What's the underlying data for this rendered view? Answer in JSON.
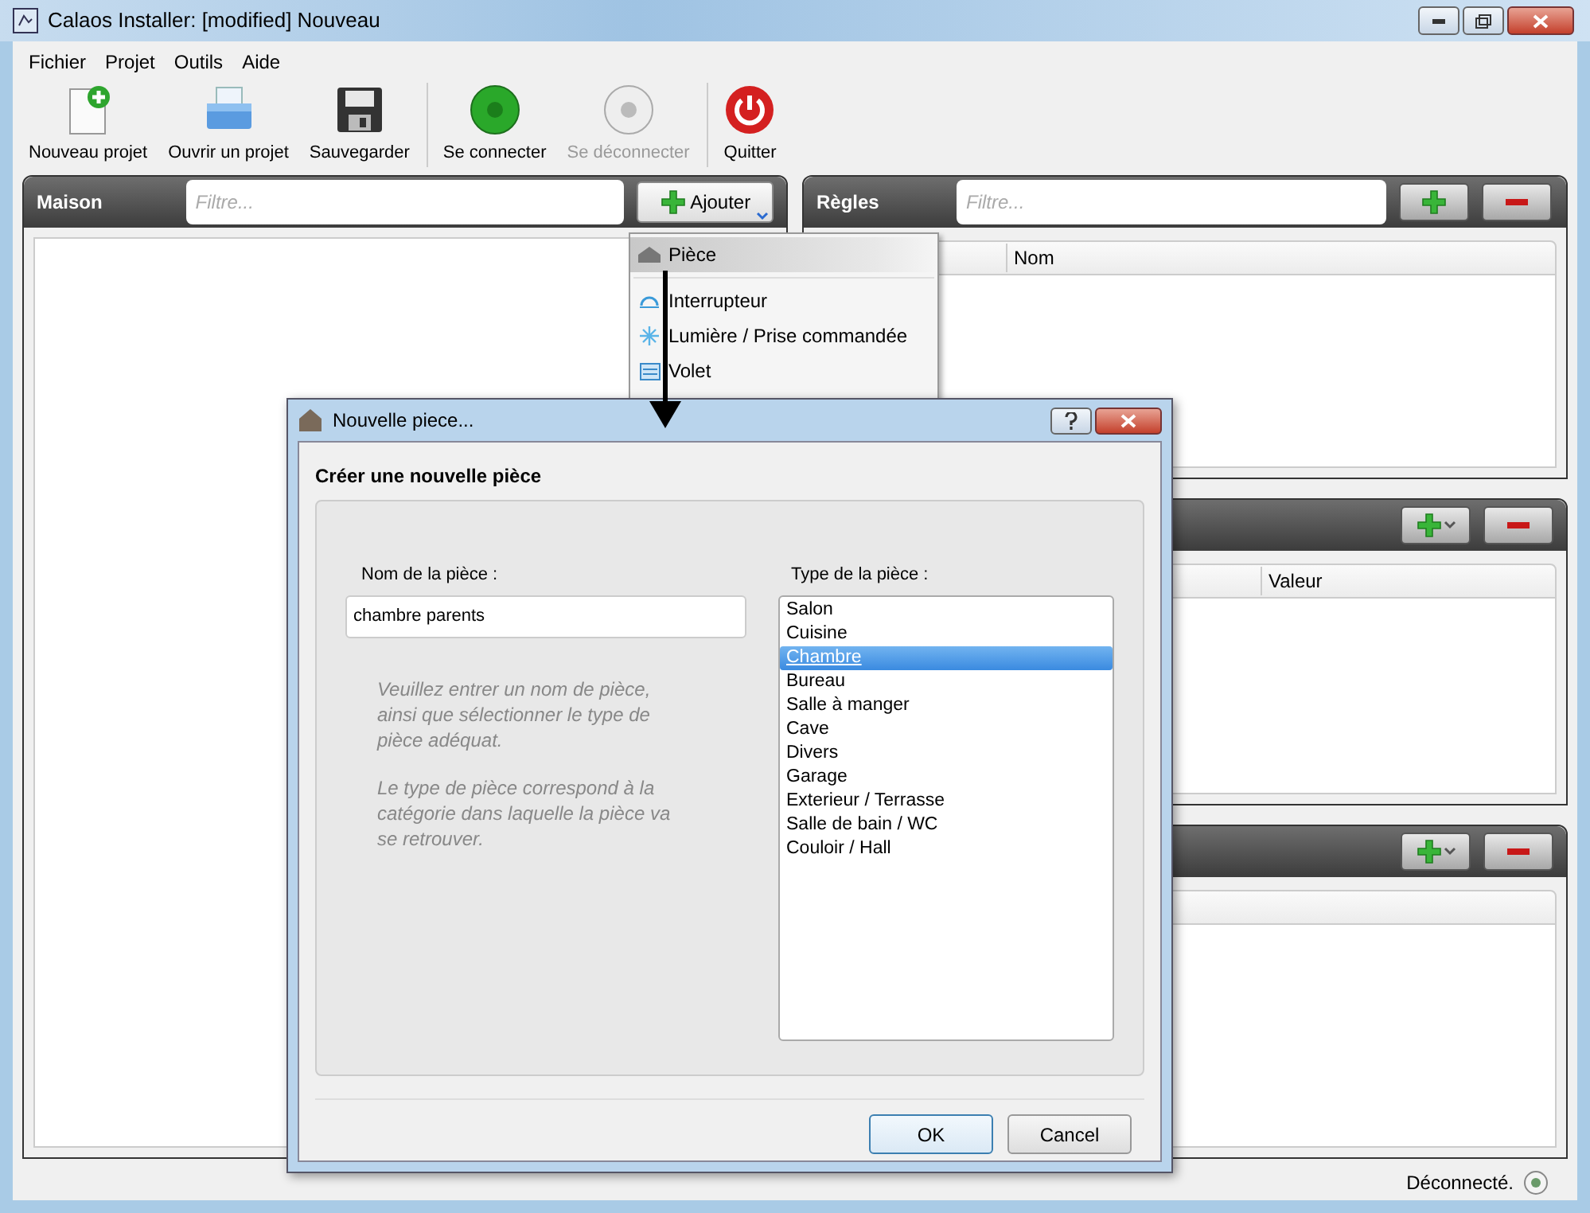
{
  "window": {
    "title": "Calaos Installer: [modified] Nouveau"
  },
  "menu": [
    "Fichier",
    "Projet",
    "Outils",
    "Aide"
  ],
  "toolbar": [
    {
      "kind": "new",
      "label": "Nouveau projet",
      "disabled": false,
      "separator_before": false
    },
    {
      "kind": "open",
      "label": "Ouvrir un projet",
      "disabled": false,
      "separator_before": false
    },
    {
      "kind": "save",
      "label": "Sauvegarder",
      "disabled": false,
      "separator_before": false
    },
    {
      "kind": "connect",
      "label": "Se connecter",
      "disabled": false,
      "separator_before": true
    },
    {
      "kind": "disconnect",
      "label": "Se déconnecter",
      "disabled": true,
      "separator_before": false
    },
    {
      "kind": "quit",
      "label": "Quitter",
      "disabled": false,
      "separator_before": true
    }
  ],
  "house_panel": {
    "title": "Maison",
    "filter": {
      "placeholder": "Filtre..."
    },
    "add_button": "Ajouter"
  },
  "rules_panel": {
    "title": "Règles",
    "filter": {
      "placeholder": "Filtre..."
    },
    "columns": [
      "Nom"
    ]
  },
  "panel_2": {
    "columns": [
      "Valeur"
    ]
  },
  "add_menu": [
    {
      "kind": "room",
      "label": "Pièce",
      "selected": true
    },
    {
      "kind": "switch",
      "label": "Interrupteur",
      "selected": false
    },
    {
      "kind": "light",
      "label": "Lumière / Prise commandée",
      "selected": false
    },
    {
      "kind": "shutter",
      "label": "Volet",
      "selected": false
    }
  ],
  "dialog": {
    "title": "Nouvelle piece...",
    "heading": "Créer une nouvelle pièce",
    "name_label": "Nom de la pièce :",
    "name_value": "chambre parents",
    "type_label": "Type de la pièce :",
    "help": [
      "Veuillez entrer un nom de pièce, ainsi que sélectionner le type de pièce adéquat.",
      "Le type de pièce correspond à la catégorie dans laquelle la pièce va se retrouver."
    ],
    "types": [
      {
        "label": "Salon",
        "selected": false
      },
      {
        "label": "Cuisine",
        "selected": false
      },
      {
        "label": "Chambre",
        "selected": true
      },
      {
        "label": "Bureau",
        "selected": false
      },
      {
        "label": "Salle à manger",
        "selected": false
      },
      {
        "label": "Cave",
        "selected": false
      },
      {
        "label": "Divers",
        "selected": false
      },
      {
        "label": "Garage",
        "selected": false
      },
      {
        "label": "Exterieur / Terrasse",
        "selected": false
      },
      {
        "label": "Salle de bain / WC",
        "selected": false
      },
      {
        "label": "Couloir / Hall",
        "selected": false
      }
    ],
    "buttons": [
      "OK",
      "Cancel"
    ]
  },
  "status_bar": {
    "text": "Déconnecté."
  }
}
